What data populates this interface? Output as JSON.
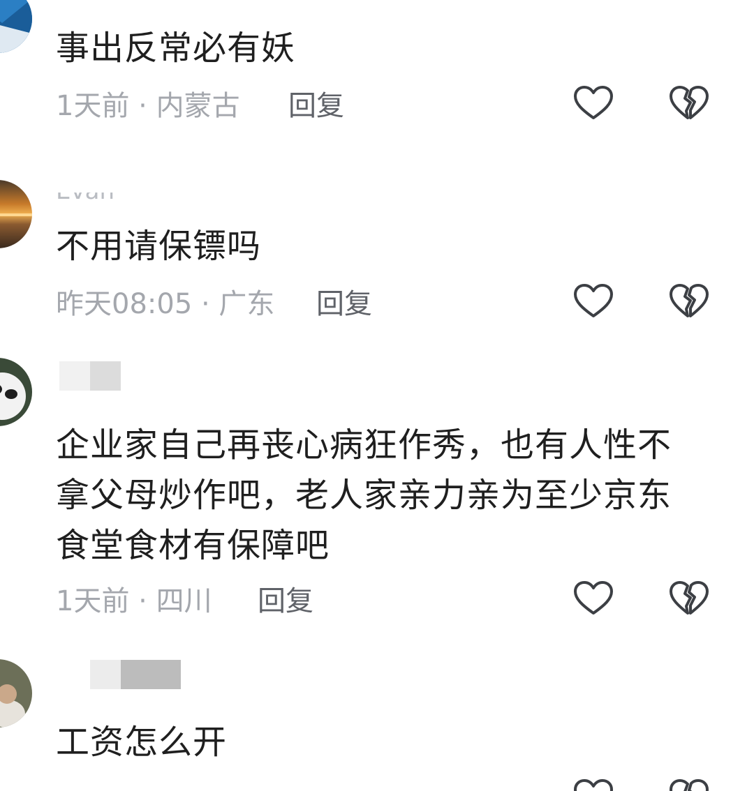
{
  "comments": [
    {
      "username": "",
      "text": "事出反常必有妖",
      "meta": "1天前 · 内蒙古",
      "reply_label": "回复"
    },
    {
      "username": "Evan",
      "text": "不用请保镖吗",
      "meta": "昨天08:05 · 广东",
      "reply_label": "回复"
    },
    {
      "username": "",
      "text": "企业家自己再丧心病狂作秀，也有人性不拿父母炒作吧，老人家亲力亲为至少京东食堂食材有保障吧",
      "meta": "1天前 · 四川",
      "reply_label": "回复"
    },
    {
      "username": "",
      "text": "工资怎么开",
      "meta": "",
      "reply_label": ""
    }
  ],
  "icons": {
    "like": "heart-outline-icon",
    "dislike": "broken-heart-icon"
  },
  "colors": {
    "comment_text": "#1f1f1f",
    "meta_text": "#a4a7ad",
    "reply_text": "#5f6268",
    "icon_stroke": "#3c3f44"
  }
}
